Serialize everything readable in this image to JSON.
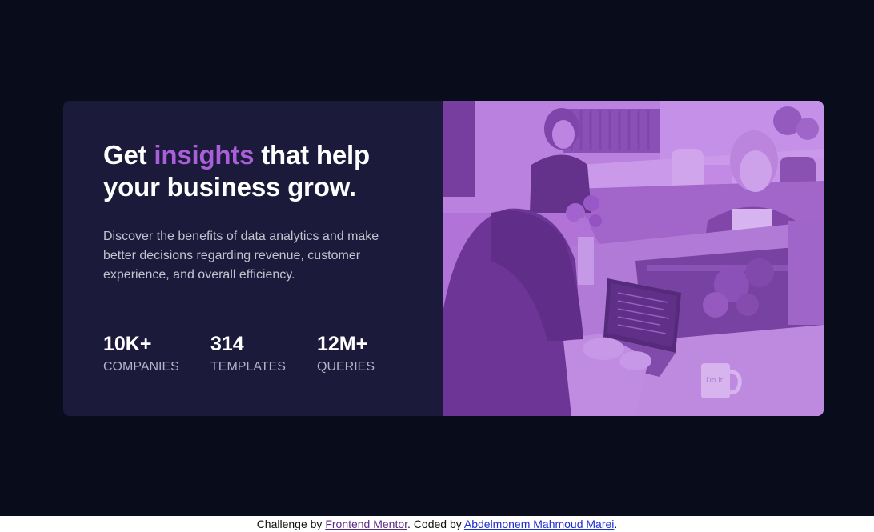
{
  "headline": {
    "part1": "Get ",
    "accent": "insights",
    "part2": " that help your business grow."
  },
  "description": "Discover the benefits of data analytics and make better decisions regarding revenue, customer experience, and overall efficiency.",
  "stats": [
    {
      "value": "10K+",
      "label": "COMPANIES"
    },
    {
      "value": "314",
      "label": "TEMPLATES"
    },
    {
      "value": "12M+",
      "label": "QUERIES"
    }
  ],
  "image": {
    "icon": "office-team-photo",
    "mug_text": "Do it"
  },
  "footer": {
    "prefix": "Challenge by ",
    "fm_link": "Frontend Mentor",
    "middle": ". Coded by ",
    "author_link": "Abdelmonem Mahmoud Marei",
    "suffix": "."
  },
  "colors": {
    "page_background": "#090c1b",
    "card_background": "#1c1a3b",
    "accent": "#a95fd8",
    "photo_overlay": "#aa5cdb"
  }
}
